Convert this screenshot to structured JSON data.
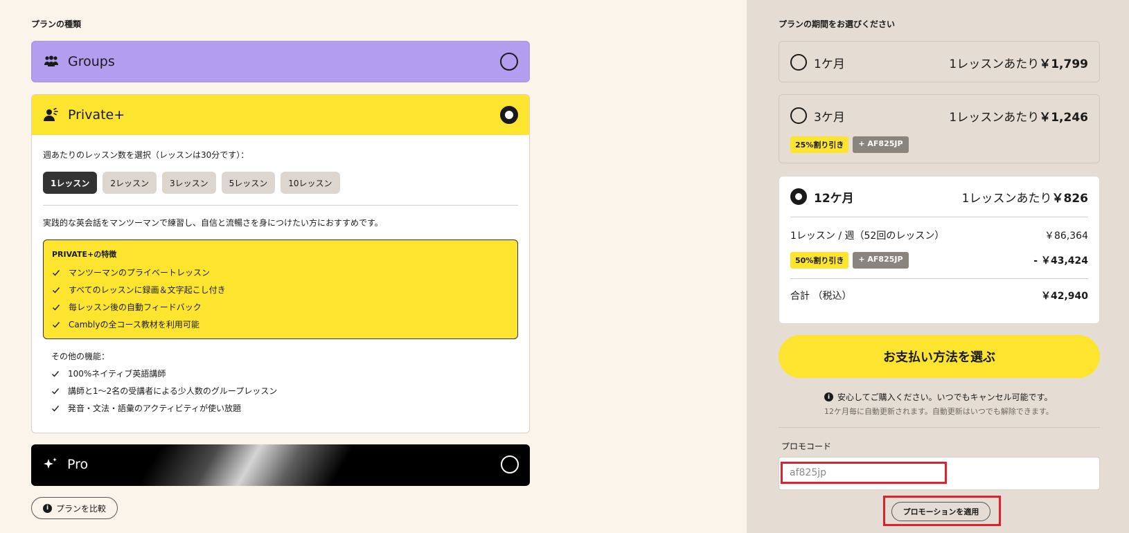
{
  "plan_type": {
    "label": "プランの種類",
    "groups": {
      "name": "Groups"
    },
    "private_plus": {
      "name": "Private+",
      "lesson_question": "週あたりのレッスン数を選択（レッスンは30分です）：",
      "lesson_options": [
        "1レッスン",
        "2レッスン",
        "3レッスン",
        "5レッスン",
        "10レッスン"
      ],
      "description": "実践的な英会話をマンツーマンで練習し、自信と流暢さを身につけたい方におすすめです。",
      "features_title": "PRIVATE+の特徴",
      "features": [
        "マンツーマンのプライベートレッスン",
        "すべてのレッスンに録画＆文字起こし付き",
        "毎レッスン後の自動フィードバック",
        "Camblyの全コース教材を利用可能"
      ],
      "other_title": "その他の機能：",
      "other_features": [
        "100%ネイティブ英語講師",
        "講師と1〜2名の受講者による少人数のグループレッスン",
        "発音・文法・語彙のアクティビティが使い放題"
      ]
    },
    "pro": {
      "name": "Pro"
    },
    "compare_label": "プランを比較"
  },
  "period": {
    "label": "プランの期間をお選びください",
    "p1": {
      "name": "1ケ月",
      "price_prefix": "1レッスンあたり",
      "price": "￥1,799"
    },
    "p3": {
      "name": "3ケ月",
      "price_prefix": "1レッスンあたり",
      "price": "￥1,246",
      "discount": "25%割り引き",
      "code": "+ AF825JP"
    },
    "p12": {
      "name": "12ケ月",
      "price_prefix": "1レッスンあたり",
      "price": "￥826",
      "line_label": "1レッスン / 週（52回のレッスン）",
      "line_value": "￥86,364",
      "discount": "50%割り引き",
      "code": "+ AF825JP",
      "discount_value": "- ￥43,424",
      "total_label": "合計 （税込）",
      "total_value": "￥42,940"
    }
  },
  "checkout": {
    "pay_label": "お支払い方法を選ぶ",
    "secure_text": "安心してご購入ください。いつでもキャンセル可能です。",
    "renew_text": "12ケ月毎に自動更新されます。自動更新はいつでも解除できます。"
  },
  "promo": {
    "label": "プロモコード",
    "value": "af825jp",
    "apply_label": "プロモーションを適用"
  },
  "colors": {
    "yellow": "#fde52f",
    "purple": "#b39def",
    "highlight_red": "#e0202a"
  }
}
